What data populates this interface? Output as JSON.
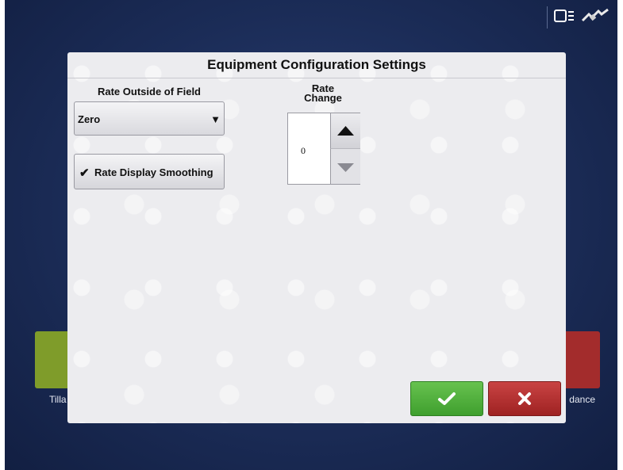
{
  "background": {
    "left_tile_label": "Tilla",
    "right_tile_label": "dance"
  },
  "status_bar": {
    "icons": [
      "display-icon",
      "gps-satellite-icon"
    ]
  },
  "dialog": {
    "title": "Equipment Configuration Settings",
    "rate_outside_field": {
      "label": "Rate Outside of Field",
      "selected": "Zero",
      "arrow": "▼"
    },
    "rate_display_smoothing": {
      "label": "Rate Display Smoothing",
      "checked": true,
      "check_glyph": "✔"
    },
    "rate_change": {
      "label_line1": "Rate",
      "label_line2": "Change",
      "value": "0"
    },
    "buttons": {
      "ok_icon": "checkmark-icon",
      "cancel_icon": "close-icon"
    }
  },
  "colors": {
    "ok": "#4caf38",
    "cancel": "#b12f2f",
    "background": "#1b2c57"
  }
}
